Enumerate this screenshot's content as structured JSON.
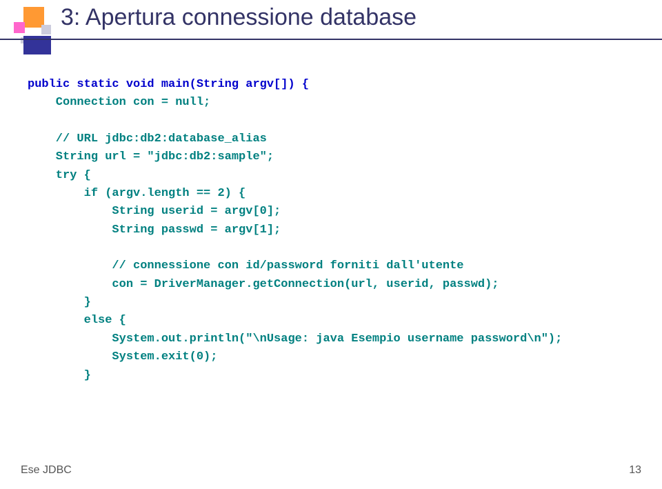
{
  "slide": {
    "title": "3: Apertura connessione database"
  },
  "code": {
    "l1": "public static void main(String argv[]) {",
    "l2": "    Connection con = null;",
    "l3": "    // URL jdbc:db2:database_alias",
    "l4": "    String url = \"jdbc:db2:sample\";",
    "l5": "    try {",
    "l6": "        if (argv.length == 2) {",
    "l7": "            String userid = argv[0];",
    "l8": "            String passwd = argv[1];",
    "l9": "            // connessione con id/password forniti dall'utente",
    "l10": "            con = DriverManager.getConnection(url, userid, passwd);",
    "l11": "        }",
    "l12": "        else {",
    "l13": "            System.out.println(\"\\nUsage: java Esempio username password\\n\");",
    "l14": "            System.exit(0);",
    "l15": "        }"
  },
  "footer": {
    "left": "Ese JDBC",
    "page": "13"
  }
}
